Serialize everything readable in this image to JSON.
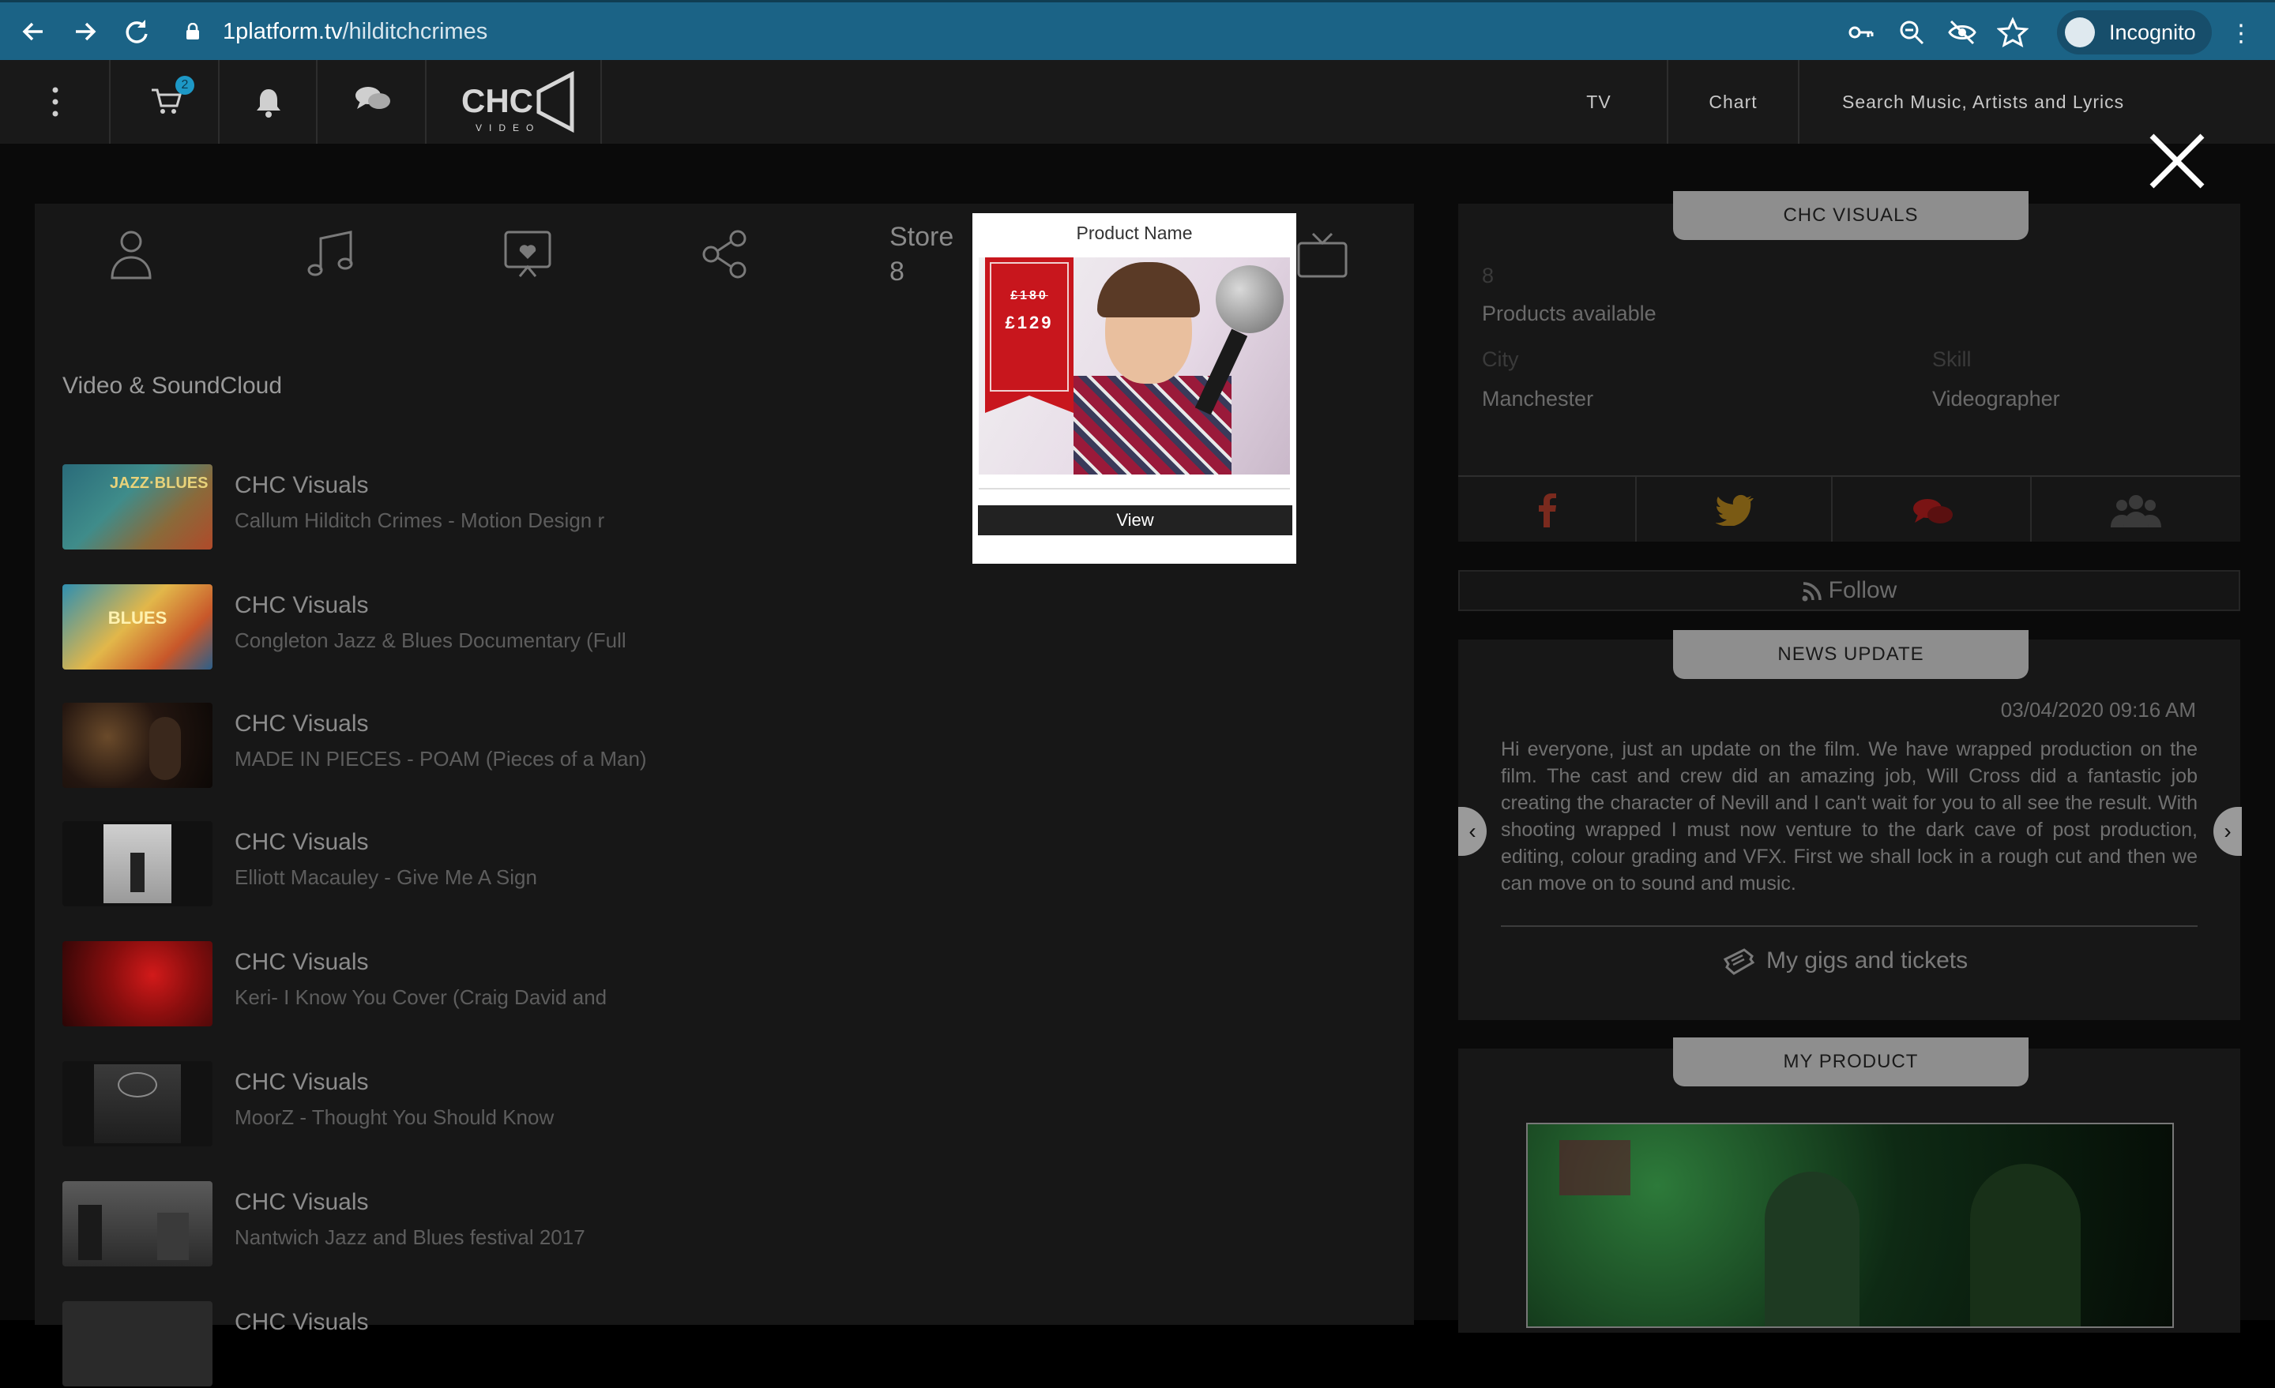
{
  "browser": {
    "url_domain": "1platform.tv",
    "url_path": "/hilditchcrimes",
    "profile_label": "Incognito"
  },
  "topbar": {
    "cart_count": "2",
    "logo_text": "CHC",
    "logo_sub": "VIDEO",
    "nav_tv": "TV",
    "nav_chart": "Chart",
    "search_placeholder": "Search Music, Artists and Lyrics"
  },
  "left": {
    "store_label": "Store",
    "store_count": "8",
    "section_title": "Video & SoundCloud",
    "videos": [
      {
        "channel": "CHC Visuals",
        "title": "Callum Hilditch Crimes - Motion Design r"
      },
      {
        "channel": "CHC Visuals",
        "title": "Congleton Jazz & Blues Documentary (Full"
      },
      {
        "channel": "CHC Visuals",
        "title": "MADE IN PIECES - POAM (Pieces of a Man)"
      },
      {
        "channel": "CHC Visuals",
        "title": "Elliott Macauley - Give Me A Sign"
      },
      {
        "channel": "CHC Visuals",
        "title": "Keri- I Know You Cover (Craig David and"
      },
      {
        "channel": "CHC Visuals",
        "title": "MoorZ - Thought You Should Know"
      },
      {
        "channel": "CHC Visuals",
        "title": "Nantwich Jazz and Blues festival 2017"
      },
      {
        "channel": "CHC Visuals",
        "title": ""
      }
    ]
  },
  "right": {
    "profile_header": "CHC VISUALS",
    "products_count": "8",
    "products_label": "Products available",
    "city_label": "City",
    "city_value": "Manchester",
    "skill_label": "Skill",
    "skill_value": "Videographer",
    "follow_label": "Follow",
    "news_header": "NEWS UPDATE",
    "news_date": "03/04/2020 09:16 AM",
    "news_body": "Hi everyone, just an update on the film. We have wrapped production on the film. The cast and crew did an amazing job, Will Cross did a fantastic job creating the character of Nevill and I can't wait for you to all see the result. With shooting wrapped I must now venture to the dark cave of post production, editing, colour grading and VFX. First we shall lock in a rough cut and then we can move on to sound and music.",
    "gigs_label": "My gigs and tickets",
    "product_header": "MY PRODUCT"
  },
  "modal": {
    "product_name": "Product Name",
    "old_price": "£180",
    "price": "£129",
    "view_label": "View"
  },
  "colors": {
    "browser_bar": "#1b6386",
    "facebook": "#7a2a1e",
    "twitter": "#7a5a14",
    "chat": "#7a1414",
    "ribbon": "#c8161d"
  },
  "icons": [
    "back-icon",
    "forward-icon",
    "reload-icon",
    "lock-icon",
    "key-icon",
    "zoom-icon",
    "eye-off-icon",
    "star-icon",
    "menu-dots-icon",
    "cart-icon",
    "bell-icon",
    "chat-icon",
    "user-icon",
    "music-icon",
    "heart-icon",
    "share-icon",
    "tv-icon",
    "close-icon",
    "rss-icon",
    "ticket-icon",
    "facebook-icon",
    "twitter-icon",
    "group-icon",
    "chevron-left-icon",
    "chevron-right-icon"
  ]
}
